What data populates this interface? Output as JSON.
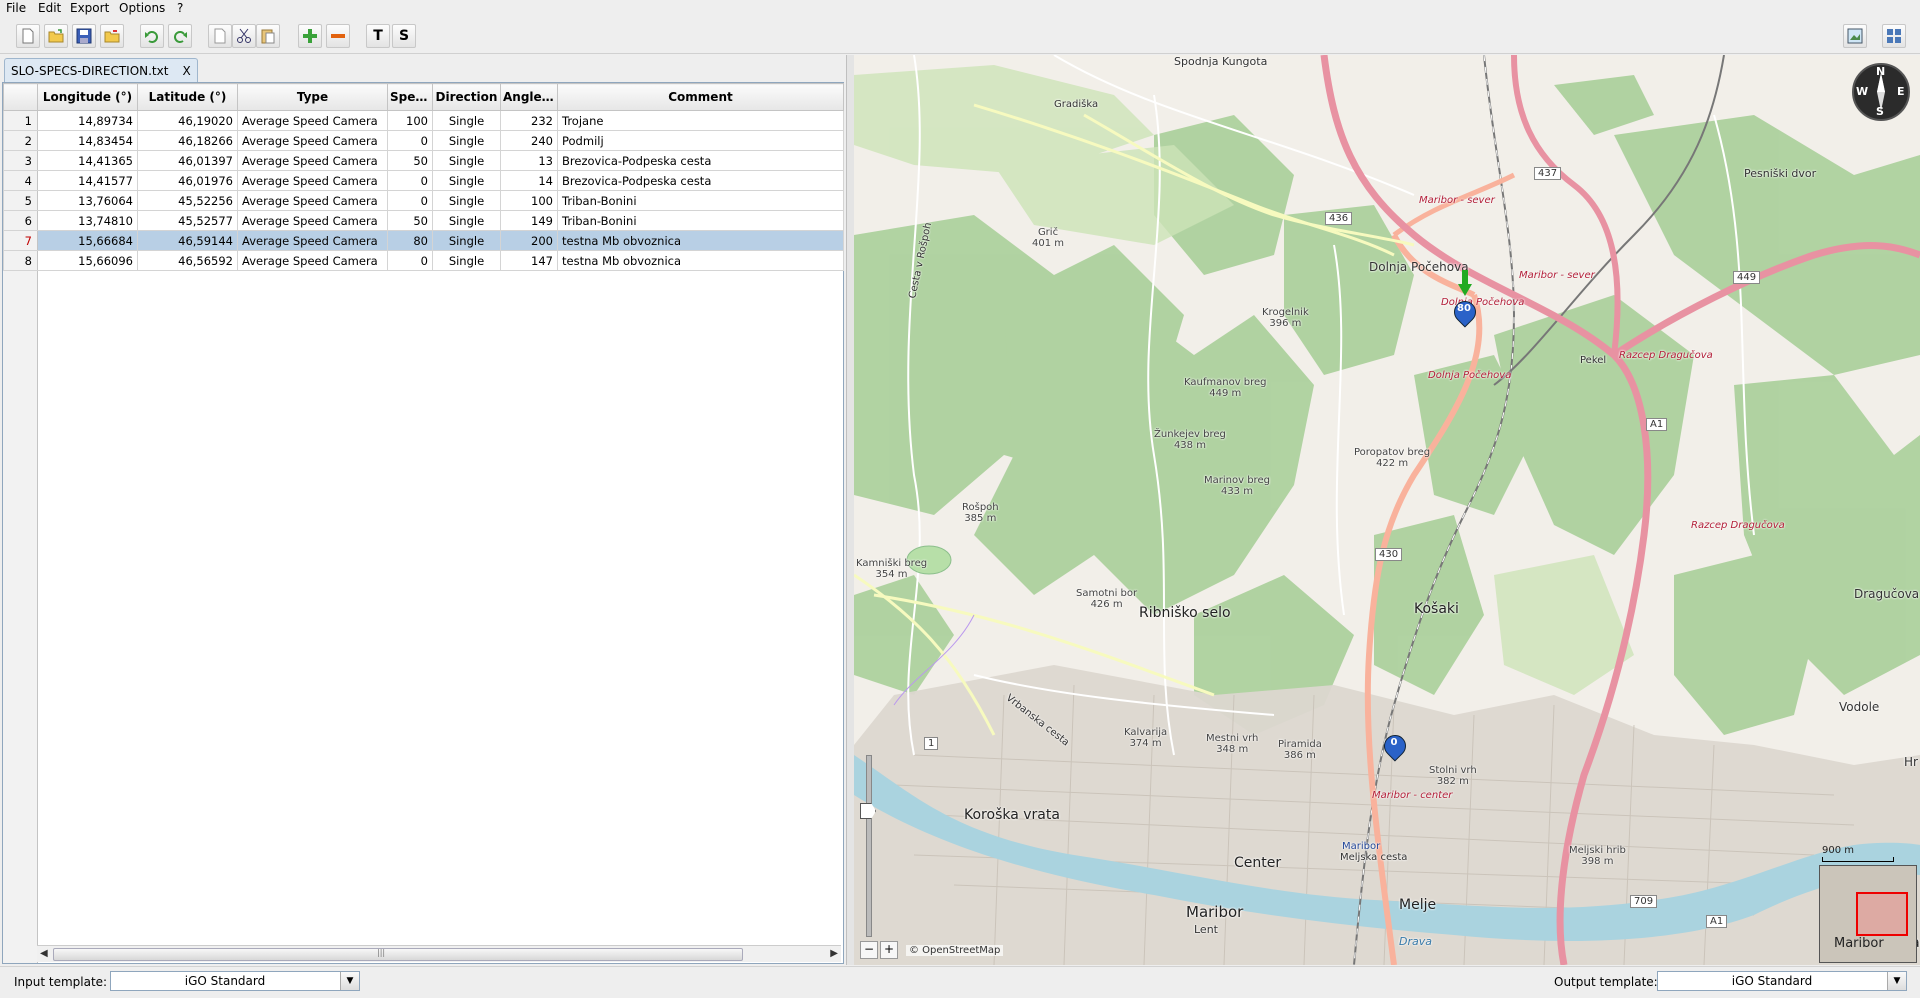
{
  "menu": [
    "File",
    "Edit",
    "Export",
    "Options",
    "?"
  ],
  "toolbar": {
    "buttons": [
      "new-file-icon",
      "open-folder-icon",
      "save-icon",
      "export-folder-icon",
      "undo-icon",
      "redo-icon",
      "copy-page-icon",
      "cut-icon",
      "paste-icon",
      "add-row-icon",
      "remove-row-icon"
    ],
    "t_label": "T",
    "s_label": "S"
  },
  "tab": {
    "title": "SLO-SPECS-DIRECTION.txt",
    "close": "X"
  },
  "table": {
    "columns": [
      "Longitude (°)",
      "Latitude (°)",
      "Type",
      "Spee...",
      "Direction",
      "Angle (°)",
      "Comment"
    ],
    "rows": [
      {
        "n": "1",
        "lon": "14,89734",
        "lat": "46,19020",
        "type": "Average Speed Camera",
        "speed": "100",
        "dir": "Single",
        "angle": "232",
        "comment": "Trojane"
      },
      {
        "n": "2",
        "lon": "14,83454",
        "lat": "46,18266",
        "type": "Average Speed Camera",
        "speed": "0",
        "dir": "Single",
        "angle": "240",
        "comment": "Podmilj"
      },
      {
        "n": "3",
        "lon": "14,41365",
        "lat": "46,01397",
        "type": "Average Speed Camera",
        "speed": "50",
        "dir": "Single",
        "angle": "13",
        "comment": "Brezovica-Podpeska cesta"
      },
      {
        "n": "4",
        "lon": "14,41577",
        "lat": "46,01976",
        "type": "Average Speed Camera",
        "speed": "0",
        "dir": "Single",
        "angle": "14",
        "comment": "Brezovica-Podpeska cesta"
      },
      {
        "n": "5",
        "lon": "13,76064",
        "lat": "45,52256",
        "type": "Average Speed Camera",
        "speed": "0",
        "dir": "Single",
        "angle": "100",
        "comment": "Triban-Bonini"
      },
      {
        "n": "6",
        "lon": "13,74810",
        "lat": "45,52577",
        "type": "Average Speed Camera",
        "speed": "50",
        "dir": "Single",
        "angle": "149",
        "comment": "Triban-Bonini"
      },
      {
        "n": "7",
        "lon": "15,66684",
        "lat": "46,59144",
        "type": "Average Speed Camera",
        "speed": "80",
        "dir": "Single",
        "angle": "200",
        "comment": "testna Mb obvoznica",
        "selected": true
      },
      {
        "n": "8",
        "lon": "15,66096",
        "lat": "46,56592",
        "type": "Average Speed Camera",
        "speed": "0",
        "dir": "Single",
        "angle": "147",
        "comment": "testna Mb obvoznica"
      }
    ]
  },
  "map": {
    "labels": {
      "spodnja_kungota": "Spodnja Kungota",
      "gradiska": "Gradiška",
      "pesniski_dvor": "Pesniški dvor",
      "maribor_sever1": "Maribor - sever",
      "maribor_sever2": "Maribor - sever",
      "dolnja_pocehova": "Dolnja Počehova",
      "dolnja_pocehova2": "Dolnja Počehova",
      "dolnja_pocehova3": "Dolnja Počehova",
      "pekel": "Pekel",
      "razcep1": "Razcep Dragučova",
      "razcep2": "Razcep Dragučova",
      "dragucova": "Dragučova",
      "vodole": "Vodole",
      "kosaki": "Košaki",
      "ribnisko_selo": "Ribniško selo",
      "koroska_vrata": "Koroška vrata",
      "center": "Center",
      "maribor": "Maribor",
      "maribor_center": "Maribor - center",
      "melje": "Melje",
      "drava": "Drava",
      "lent": "Lent",
      "ma": "Ma",
      "hr": "Hr",
      "cesta_rospoh": "Cesta v Rošpoh",
      "vrbanska": "Vrbanska cesta",
      "meljska": "Meljska cesta",
      "mariborsign": "Maribor"
    },
    "peaks": [
      {
        "name": "Grič",
        "elev": "401 m"
      },
      {
        "name": "Krogelnik",
        "elev": "396 m"
      },
      {
        "name": "Kaufmanov breg",
        "elev": "449 m"
      },
      {
        "name": "Žunkejev breg",
        "elev": "438 m"
      },
      {
        "name": "Marinov breg",
        "elev": "433 m"
      },
      {
        "name": "Poropatov breg",
        "elev": "422 m"
      },
      {
        "name": "Rošpoh",
        "elev": "385 m"
      },
      {
        "name": "Kamniški breg",
        "elev": "354 m"
      },
      {
        "name": "Samotni bor",
        "elev": "426 m"
      },
      {
        "name": "Kalvarija",
        "elev": "374 m"
      },
      {
        "name": "Mestni vrh",
        "elev": "348 m"
      },
      {
        "name": "Piramida",
        "elev": "386 m"
      },
      {
        "name": "Stolni vrh",
        "elev": "382 m"
      },
      {
        "name": "Meljski hrib",
        "elev": "398 m"
      }
    ],
    "shields": [
      "436",
      "437",
      "449",
      "A1",
      "430",
      "1",
      "709",
      "A1"
    ],
    "markers": [
      {
        "label": "80"
      },
      {
        "label": "0"
      }
    ],
    "compass": {
      "n": "N",
      "s": "S",
      "e": "E",
      "w": "W"
    },
    "zoom_minus": "−",
    "zoom_plus": "+",
    "attribution": "© OpenStreetMap",
    "scale": "900 m",
    "minimap_label": "Maribor"
  },
  "footer": {
    "input_label": "Input template:",
    "input_value": "iGO Standard",
    "output_label": "Output template:",
    "output_value": "iGO Standard"
  },
  "colors": {
    "selection": "#b8cfe5",
    "highway": "#e892a2",
    "trunk": "#f9b29c",
    "forest": "#add19e",
    "river": "#aad3df"
  }
}
